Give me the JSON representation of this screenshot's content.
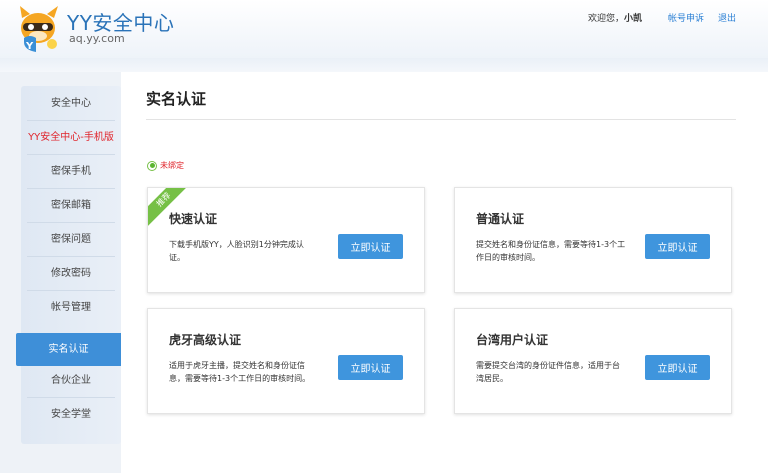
{
  "header": {
    "title": "YY安全中心",
    "subtitle": "aq.yy.com",
    "welcome_prefix": "欢迎您，",
    "username": "小凯",
    "appeal_link": "帐号申诉",
    "logout_link": "退出"
  },
  "sidebar": {
    "items": [
      {
        "label": "安全中心"
      },
      {
        "label": "YY安全中心-手机版"
      },
      {
        "label": "密保手机"
      },
      {
        "label": "密保邮箱"
      },
      {
        "label": "密保问题"
      },
      {
        "label": "修改密码"
      },
      {
        "label": "帐号管理"
      },
      {
        "label": "实名认证"
      },
      {
        "label": "合伙企业"
      },
      {
        "label": "安全学堂"
      }
    ],
    "active_index": 7
  },
  "main": {
    "title": "实名认证",
    "status": "未绑定",
    "cards": [
      {
        "title": "快速认证",
        "desc": "下载手机版YY，人脸识别1分钟完成认证。",
        "button": "立即认证",
        "ribbon": "推荐"
      },
      {
        "title": "普通认证",
        "desc": "提交姓名和身份证信息，需要等待1-3个工作日的审核时间。",
        "button": "立即认证"
      },
      {
        "title": "虎牙高级认证",
        "desc": "适用于虎牙主播，提交姓名和身份证信息，需要等待1-3个工作日的审核时间。",
        "button": "立即认证"
      },
      {
        "title": "台湾用户认证",
        "desc": "需要提交台湾的身份证件信息，适用于台湾居民。",
        "button": "立即认证"
      }
    ]
  },
  "colors": {
    "accent": "#3f95dd",
    "warning": "#e0242b",
    "ribbon": "#76c046"
  }
}
